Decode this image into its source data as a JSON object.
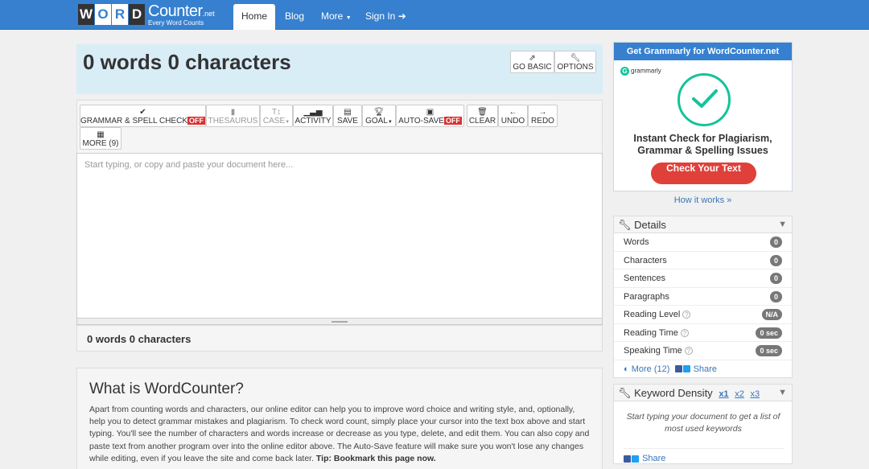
{
  "nav": {
    "logo_letters": [
      "W",
      "O",
      "R",
      "D"
    ],
    "logo_letter_colors": [
      "#333333",
      "#3680cf",
      "#3680cf",
      "#333333"
    ],
    "logo_main": "Counter",
    "logo_net": ".net",
    "logo_sub": "Every Word Counts",
    "home": "Home",
    "blog": "Blog",
    "more": "More",
    "signin": "Sign In"
  },
  "header": {
    "title": "0 words 0 characters",
    "go_basic": "GO BASIC",
    "options": "OPTIONS"
  },
  "toolbar": {
    "grammar": "GRAMMAR & SPELL CHECK",
    "grammar_state": "OFF",
    "thesaurus": "THESAURUS",
    "case": "CASE",
    "activity": "ACTIVITY",
    "save": "SAVE",
    "goal": "GOAL",
    "autosave": "AUTO-SAVE",
    "autosave_state": "OFF",
    "clear": "CLEAR",
    "undo": "UNDO",
    "redo": "REDO",
    "more": "MORE (9)"
  },
  "editor": {
    "placeholder": "Start typing, or copy and paste your document here..."
  },
  "footer_count": "0 words 0 characters",
  "about": {
    "title": "What is WordCounter?",
    "body": "Apart from counting words and characters, our online editor can help you to improve word choice and writing style, and, optionally, help you to detect grammar mistakes and plagiarism. To check word count, simply place your cursor into the text box above and start typing. You'll see the number of characters and words increase or decrease as you type, delete, and edit them. You can also copy and paste text from another program over into the online editor above. The Auto-Save feature will make sure you won't lose any changes while editing, even if you leave the site and come back later.",
    "tip": "Tip: Bookmark this page now."
  },
  "ad": {
    "header": "Get Grammarly for WordCounter.net",
    "brand": "grammarly",
    "headline_1": "Instant Check for Plagiarism,",
    "headline_2": "Grammar & Spelling Issues",
    "cta": "Check Your Text",
    "link": "How it works »",
    "accent": "#15c39a",
    "cta_color": "#e0403a"
  },
  "details": {
    "title": "Details",
    "rows": [
      {
        "label": "Words",
        "value": "0",
        "help": false
      },
      {
        "label": "Characters",
        "value": "0",
        "help": false
      },
      {
        "label": "Sentences",
        "value": "0",
        "help": false
      },
      {
        "label": "Paragraphs",
        "value": "0",
        "help": false
      },
      {
        "label": "Reading Level",
        "value": "N/A",
        "help": true
      },
      {
        "label": "Reading Time",
        "value": "0 sec",
        "help": true
      },
      {
        "label": "Speaking Time",
        "value": "0 sec",
        "help": true
      }
    ],
    "more": "More (12)",
    "share": "Share"
  },
  "keyword_density": {
    "title": "Keyword Density",
    "x1": "x1",
    "x2": "x2",
    "x3": "x3",
    "empty_text": "Start typing your document to get a list of most used keywords",
    "share": "Share"
  }
}
